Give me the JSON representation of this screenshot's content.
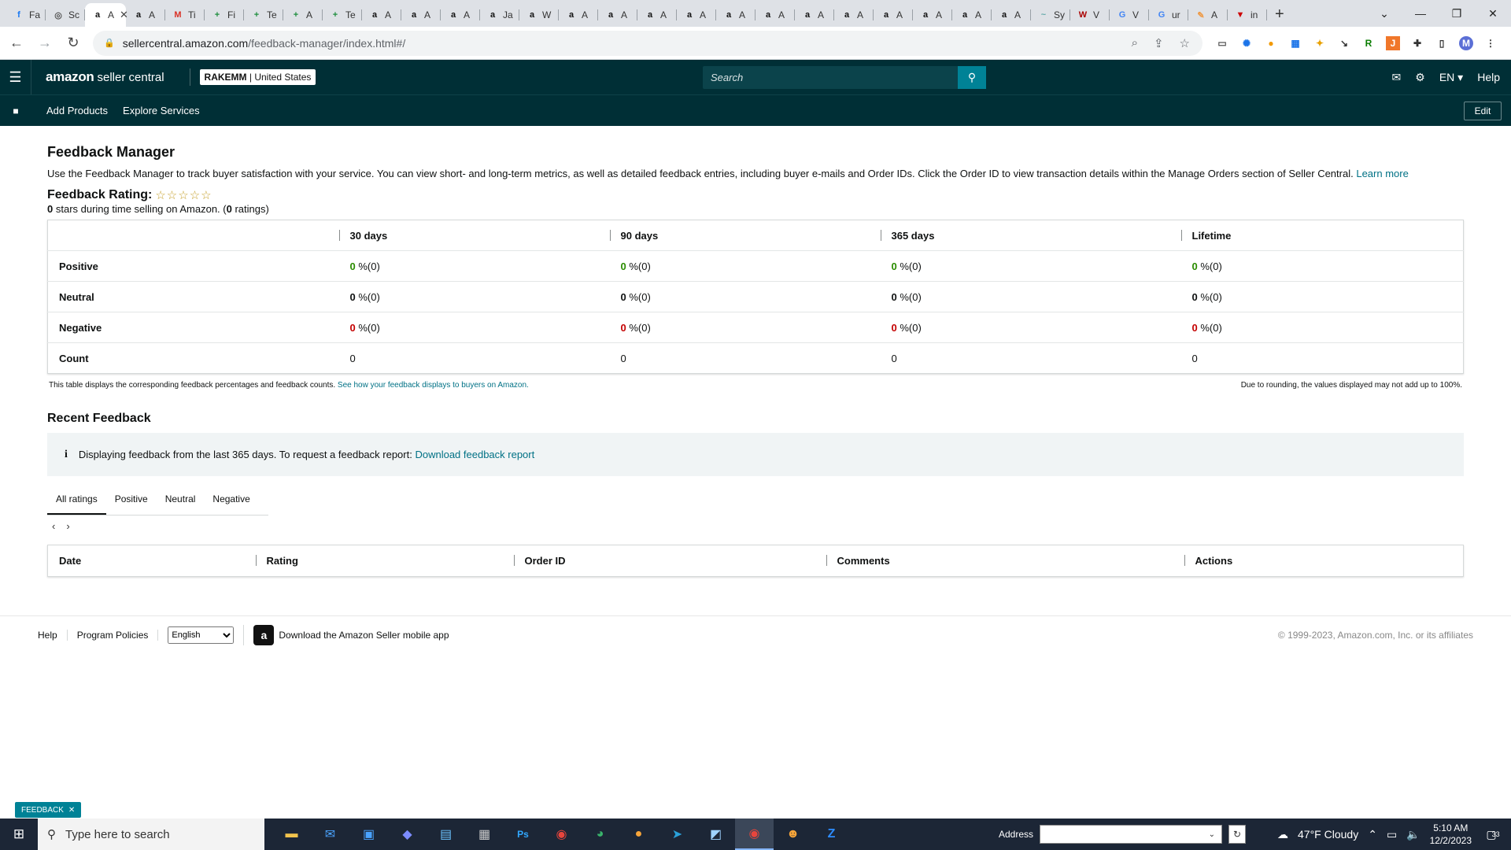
{
  "browser": {
    "tabs": [
      {
        "icon": "f",
        "label": "Fa",
        "color": "#1877f2"
      },
      {
        "icon": "◎",
        "label": "Sc",
        "color": "#555"
      },
      {
        "icon": "a",
        "label": "A",
        "color": "#111",
        "active": true
      },
      {
        "icon": "a",
        "label": "A",
        "color": "#111"
      },
      {
        "icon": "M",
        "label": "Ti",
        "color": "#d93025"
      },
      {
        "icon": "+",
        "label": "Fi",
        "color": "#1e8e3e"
      },
      {
        "icon": "+",
        "label": "Te",
        "color": "#1e8e3e"
      },
      {
        "icon": "+",
        "label": "A",
        "color": "#1e8e3e"
      },
      {
        "icon": "+",
        "label": "Te",
        "color": "#1e8e3e"
      },
      {
        "icon": "a",
        "label": "A",
        "color": "#111"
      },
      {
        "icon": "a",
        "label": "A",
        "color": "#111"
      },
      {
        "icon": "a",
        "label": "A",
        "color": "#111"
      },
      {
        "icon": "a",
        "label": "Ja",
        "color": "#111"
      },
      {
        "icon": "a",
        "label": "W",
        "color": "#111"
      },
      {
        "icon": "a",
        "label": "A",
        "color": "#111"
      },
      {
        "icon": "a",
        "label": "A",
        "color": "#111"
      },
      {
        "icon": "a",
        "label": "A",
        "color": "#111"
      },
      {
        "icon": "a",
        "label": "A",
        "color": "#111"
      },
      {
        "icon": "a",
        "label": "A",
        "color": "#111"
      },
      {
        "icon": "a",
        "label": "A",
        "color": "#111"
      },
      {
        "icon": "a",
        "label": "A",
        "color": "#111"
      },
      {
        "icon": "a",
        "label": "A",
        "color": "#111"
      },
      {
        "icon": "a",
        "label": "A",
        "color": "#111"
      },
      {
        "icon": "a",
        "label": "A",
        "color": "#111"
      },
      {
        "icon": "a",
        "label": "A",
        "color": "#111"
      },
      {
        "icon": "a",
        "label": "A",
        "color": "#111"
      },
      {
        "icon": "~",
        "label": "Sy",
        "color": "#6aa"
      },
      {
        "icon": "W",
        "label": "V",
        "color": "#a00"
      },
      {
        "icon": "G",
        "label": "V",
        "color": "#4285f4"
      },
      {
        "icon": "G",
        "label": "ur",
        "color": "#4285f4"
      },
      {
        "icon": "✎",
        "label": "A",
        "color": "#e94"
      },
      {
        "icon": "▼",
        "label": "in",
        "color": "#c00"
      }
    ],
    "url_host": "sellercentral.amazon.com",
    "url_path": "/feedback-manager/index.html#/",
    "profile_initial": "M"
  },
  "header": {
    "logo_amazon": "amazon",
    "logo_suffix": "seller central",
    "account_name": "RAKEMM",
    "account_region": "| United States",
    "search_placeholder": "Search",
    "language": "EN ▾",
    "help": "Help"
  },
  "subnav": {
    "items": [
      "Add Products",
      "Explore Services"
    ],
    "edit": "Edit"
  },
  "page": {
    "title": "Feedback Manager",
    "intro": "Use the Feedback Manager to track buyer satisfaction with your service. You can view short- and long-term metrics, as well as detailed feedback entries, including buyer e-mails and Order IDs. Click the Order ID to view transaction details within the Manage Orders section of Seller Central.",
    "learn_more": "Learn more",
    "rating_label": "Feedback Rating:",
    "stars": "☆☆☆☆☆",
    "stars_value": "0",
    "stars_text_1": " stars during time selling on Amazon. (",
    "ratings_count": "0",
    "stars_text_2": " ratings)"
  },
  "feedback_table": {
    "columns": [
      "30 days",
      "90 days",
      "365 days",
      "Lifetime"
    ],
    "rows": [
      {
        "label": "Positive",
        "kind": "pos",
        "cells": [
          "0",
          "0",
          "0",
          "0"
        ],
        "suffix": " %(0)"
      },
      {
        "label": "Neutral",
        "kind": "neu",
        "cells": [
          "0",
          "0",
          "0",
          "0"
        ],
        "suffix": " %(0)"
      },
      {
        "label": "Negative",
        "kind": "neg",
        "cells": [
          "0",
          "0",
          "0",
          "0"
        ],
        "suffix": " %(0)"
      },
      {
        "label": "Count",
        "kind": "count",
        "cells": [
          "0",
          "0",
          "0",
          "0"
        ],
        "suffix": ""
      }
    ],
    "note_left": "This table displays the corresponding feedback percentages and feedback counts.",
    "note_link": "See how your feedback displays to buyers on Amazon.",
    "note_right": "Due to rounding, the values displayed may not add up to 100%."
  },
  "recent": {
    "title": "Recent Feedback",
    "info_text": "Displaying feedback from the last 365 days. To request a feedback report:",
    "info_link": "Download feedback report",
    "tabs": [
      "All ratings",
      "Positive",
      "Neutral",
      "Negative"
    ],
    "columns": [
      "Date",
      "Rating",
      "Order ID",
      "Comments",
      "Actions"
    ]
  },
  "footer": {
    "help": "Help",
    "policies": "Program Policies",
    "language_selected": "English",
    "app_text": "Download the Amazon Seller mobile app",
    "copyright": "© 1999-2023, Amazon.com, Inc. or its affiliates"
  },
  "feedback_button": "FEEDBACK",
  "taskbar": {
    "search_placeholder": "Type here to search",
    "address_label": "Address",
    "weather": "47°F  Cloudy",
    "time": "5:10 AM",
    "date": "12/2/2023",
    "notif_count": "33"
  }
}
